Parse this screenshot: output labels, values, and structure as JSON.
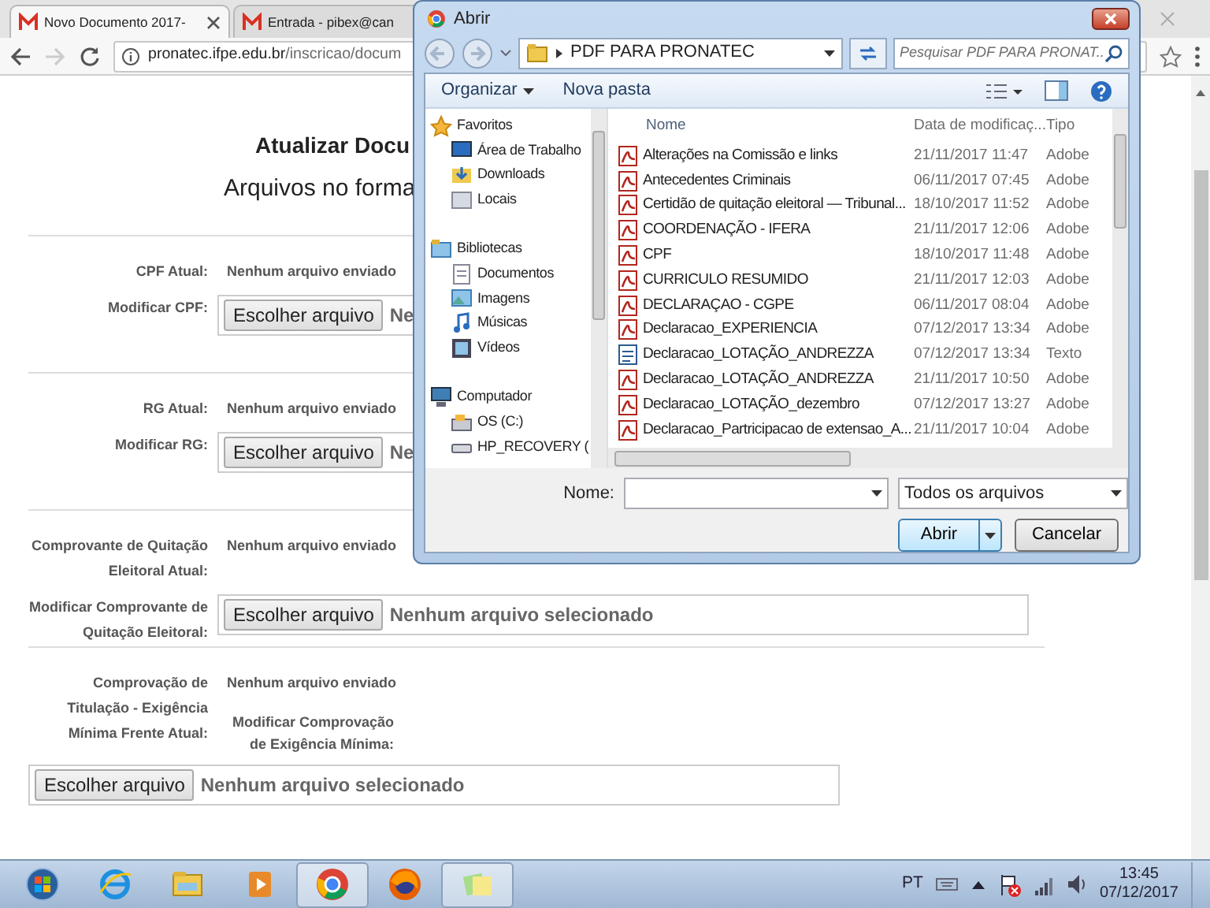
{
  "browser": {
    "tabs": [
      {
        "title": "Novo Documento 2017-",
        "selected": true
      },
      {
        "title": "Entrada - pibex@can",
        "selected": false
      }
    ],
    "url": {
      "host": "pronatec.ifpe.edu.br",
      "path": "/inscricao/docum"
    }
  },
  "page": {
    "title": "Atualizar Docu",
    "subtitle": "Arquivos no forma",
    "sections": [
      {
        "kind": "inline",
        "current_label": "CPF Atual:",
        "current_value": "Nenhum arquivo enviado",
        "modify_label": "Modificar CPF:",
        "file_button": "Escolher arquivo",
        "file_status": "Ne"
      },
      {
        "kind": "inline",
        "current_label": "RG Atual:",
        "current_value": "Nenhum arquivo enviado",
        "modify_label": "Modificar RG:",
        "file_button": "Escolher arquivo",
        "file_status": "Ne"
      },
      {
        "kind": "inline",
        "current_label": "Comprovante de Quitação Eleitoral Atual:",
        "current_value": "Nenhum arquivo enviado",
        "modify_label": "Modificar Comprovante de Quitação Eleitoral:",
        "file_button": "Escolher arquivo",
        "file_status": "Nenhum arquivo selecionado"
      },
      {
        "kind": "stacked",
        "current_label": "Comprovação de Titulação - Exigência Mínima Frente Atual:",
        "current_value": "Nenhum arquivo enviado",
        "modify_label": "Modificar Comprovação de Exigência Mínima:",
        "file_button": "Escolher arquivo",
        "file_status": "Nenhum arquivo selecionado"
      }
    ]
  },
  "dialog": {
    "title": "Abrir",
    "path": "PDF PARA PRONATEC",
    "search": {
      "placeholder": "Pesquisar PDF PARA PRONAT..."
    },
    "toolbar": [
      "Organizar",
      "Nova pasta"
    ],
    "nav": [
      {
        "label": "Favoritos",
        "children": [
          {
            "label": "Área de Trabalho"
          },
          {
            "label": "Downloads"
          },
          {
            "label": "Locais"
          }
        ]
      },
      {
        "label": "Bibliotecas",
        "children": [
          {
            "label": "Documentos"
          },
          {
            "label": "Imagens"
          },
          {
            "label": "Músicas"
          },
          {
            "label": "Vídeos"
          }
        ]
      },
      {
        "label": "Computador",
        "children": [
          {
            "label": "OS (C:)"
          },
          {
            "label": "HP_RECOVERY ("
          }
        ]
      }
    ],
    "columns": [
      "Nome",
      "Data de modificaç...",
      "Tipo"
    ],
    "files": [
      {
        "kind": "pdf",
        "name": "Alterações na Comissão e links",
        "date": "21/11/2017 11:47",
        "type": "Adobe"
      },
      {
        "kind": "pdf",
        "name": "Antecedentes Criminais",
        "date": "06/11/2017 07:45",
        "type": "Adobe"
      },
      {
        "kind": "pdf",
        "name": "Certidão de quitação eleitoral — Tribunal...",
        "date": "18/10/2017 11:52",
        "type": "Adobe"
      },
      {
        "kind": "pdf",
        "name": "COORDENAÇÃO - IFERA",
        "date": "21/11/2017 12:06",
        "type": "Adobe"
      },
      {
        "kind": "pdf",
        "name": "CPF",
        "date": "18/10/2017 11:48",
        "type": "Adobe"
      },
      {
        "kind": "pdf",
        "name": "CURRICULO RESUMIDO",
        "date": "21/11/2017 12:03",
        "type": "Adobe"
      },
      {
        "kind": "pdf",
        "name": "DECLARAÇAO - CGPE",
        "date": "06/11/2017 08:04",
        "type": "Adobe"
      },
      {
        "kind": "pdf",
        "name": "Declaracao_EXPERIENCIA",
        "date": "07/12/2017 13:34",
        "type": "Adobe"
      },
      {
        "kind": "text",
        "name": "Declaracao_LOTAÇÃO_ANDREZZA",
        "date": "07/12/2017 13:34",
        "type": "Texto"
      },
      {
        "kind": "pdf",
        "name": "Declaracao_LOTAÇÃO_ANDREZZA",
        "date": "21/11/2017 10:50",
        "type": "Adobe"
      },
      {
        "kind": "pdf",
        "name": "Declaracao_LOTAÇÃO_dezembro",
        "date": "07/12/2017 13:27",
        "type": "Adobe"
      },
      {
        "kind": "pdf",
        "name": "Declaracao_Partricipacao de extensao_A...",
        "date": "21/11/2017 10:04",
        "type": "Adobe"
      }
    ],
    "filename_label": "Nome:",
    "filter": "Todos os arquivos",
    "open_button": "Abrir",
    "cancel_button": "Cancelar"
  },
  "taskbar": {
    "apps": [
      {
        "open": false
      },
      {
        "open": false
      },
      {
        "open": false
      },
      {
        "open": false
      },
      {
        "open": true
      },
      {
        "open": false
      },
      {
        "open": true
      }
    ],
    "language": "PT",
    "time": "13:45",
    "date": "07/12/2017"
  }
}
